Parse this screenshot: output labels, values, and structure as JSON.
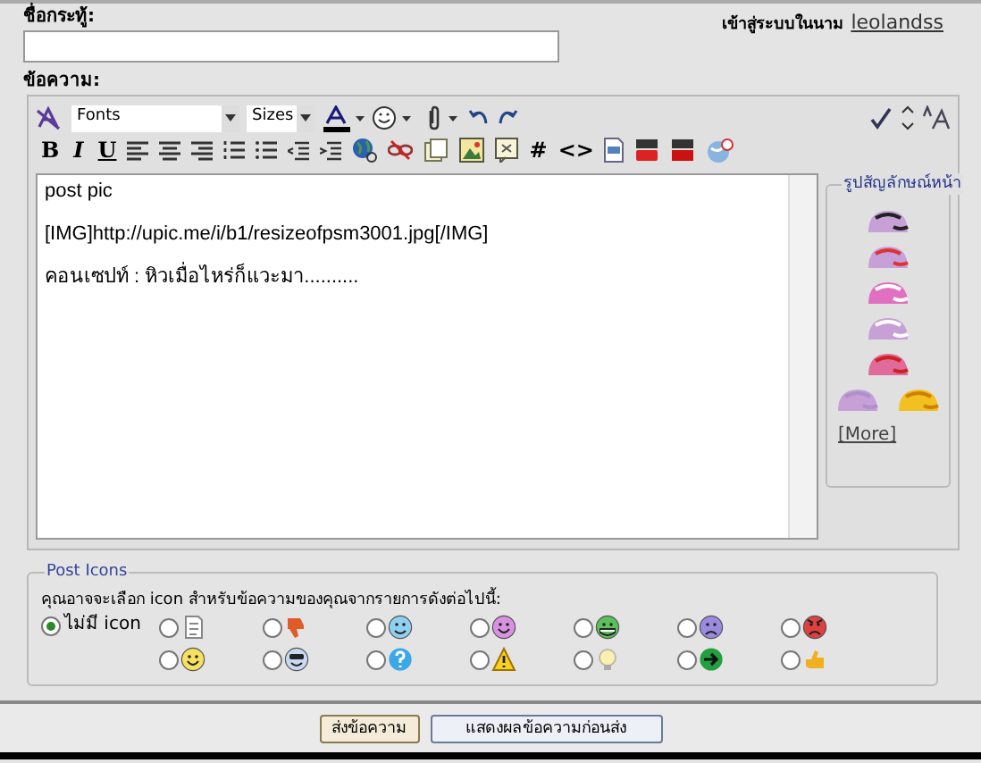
{
  "subject": {
    "label": "ชื่อกระทู้:"
  },
  "login": {
    "prefix": "เข้าสู่ระบบในนาม",
    "user": "leolandss"
  },
  "message": {
    "label": "ข้อความ:"
  },
  "toolbar": {
    "font": "Fonts",
    "size": "Sizes",
    "format_buttons": [
      "B",
      "I",
      "U"
    ],
    "code_buttons": [
      "#",
      "<>"
    ]
  },
  "editor_lines": [
    "post pic",
    "[IMG]http://upic.me/i/b1/resizeofpsm3001.jpg[/IMG]",
    "คอนเซปท์ : หิวเมื่อไหร่ก็แวะมา.........."
  ],
  "smilies": {
    "title": "รูปสัญลักษณ์หน้า",
    "more": "[More]"
  },
  "post_icons": {
    "title": "Post Icons",
    "hint": "คุณอาจจะเลือก icon สำหรับข้อความของคุณจากรายการดังต่อไปนี้:",
    "none_option": {
      "label": "ไม่มี icon",
      "selected": true
    },
    "icons": [
      {
        "kind": "page",
        "selected": false
      },
      {
        "kind": "thumbdown",
        "selected": false
      },
      {
        "kind": "wink",
        "selected": false
      },
      {
        "kind": "happy",
        "selected": false
      },
      {
        "kind": "grin",
        "selected": false
      },
      {
        "kind": "sad",
        "selected": false
      },
      {
        "kind": "angry",
        "selected": false
      },
      {
        "kind": "smile",
        "selected": false
      },
      {
        "kind": "cool",
        "selected": false
      },
      {
        "kind": "question",
        "selected": false
      },
      {
        "kind": "warning",
        "selected": false
      },
      {
        "kind": "bulb",
        "selected": false
      },
      {
        "kind": "arrow",
        "selected": false
      },
      {
        "kind": "thumbup",
        "selected": false
      }
    ]
  },
  "buttons": [
    "ส่งข้อความ",
    "แสดงผลข้อความก่อนส่ง"
  ]
}
